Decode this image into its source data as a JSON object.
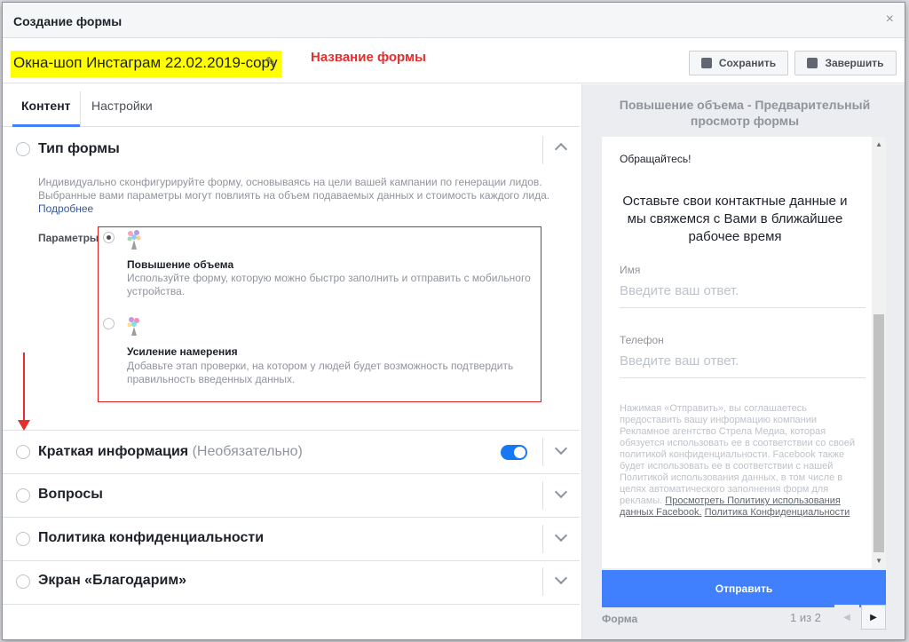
{
  "dialog": {
    "title": "Создание формы",
    "close": "×"
  },
  "form_name": {
    "value": "Окна-шоп Инстаграм 22.02.2019-copy",
    "annotation": "Название формы"
  },
  "toolbar": {
    "save_label": "Сохранить",
    "finish_label": "Завершить"
  },
  "tabs": [
    {
      "label": "Контент",
      "active": true
    },
    {
      "label": "Настройки",
      "active": false
    }
  ],
  "sections": {
    "form_type": {
      "title": "Тип формы",
      "description": "Индивидуально сконфигурируйте форму, основываясь на цели вашей кампании по генерации лидов. Выбранные вами параметры могут повлиять на объем подаваемых данных и стоимость каждого лида.",
      "more_link": "Подробнее",
      "params_label": "Параметры",
      "options": [
        {
          "title": "Повышение объема",
          "description": "Используйте форму, которую можно быстро заполнить и отправить с мобильного устройства.",
          "selected": true
        },
        {
          "title": "Усиление намерения",
          "description": "Добавьте этап проверки, на котором у людей будет возможность подтвердить правильность введенных данных.",
          "selected": false
        }
      ]
    },
    "intro": {
      "title": "Краткая информация",
      "optional": "(Необязательно)",
      "enabled": true
    },
    "questions": {
      "title": "Вопросы"
    },
    "privacy": {
      "title": "Политика конфиденциальности"
    },
    "thanks": {
      "title": "Экран «Благодарим»"
    }
  },
  "preview": {
    "title": "Повышение объема - Предварительный просмотр формы",
    "greeting": "Обращайтесь!",
    "headline": "Оставьте свои контактные данные и мы свяжемся с Вами в ближайшее рабочее время",
    "fields": [
      {
        "label": "Имя",
        "placeholder": "Введите ваш ответ."
      },
      {
        "label": "Телефон",
        "placeholder": "Введите ваш ответ."
      }
    ],
    "disclaimer_text": "Нажимая «Отправить», вы соглашаетесь предоставить вашу информацию компании Рекламное агентство Стрела Медиа, которая обязуется использовать ее в соответствии со своей политикой конфиденциальности. Facebook также будет использовать ее в соответствии с нашей Политикой использования данных, в том числе в целях автоматического заполнения форм для рекламы.",
    "disclaimer_link1": "Просмотреть Политику использования данных Facebook.",
    "disclaimer_link2": "Политика Конфиденциальности",
    "submit_label": "Отправить",
    "footer_label": "Форма",
    "pager": "1 из 2"
  }
}
